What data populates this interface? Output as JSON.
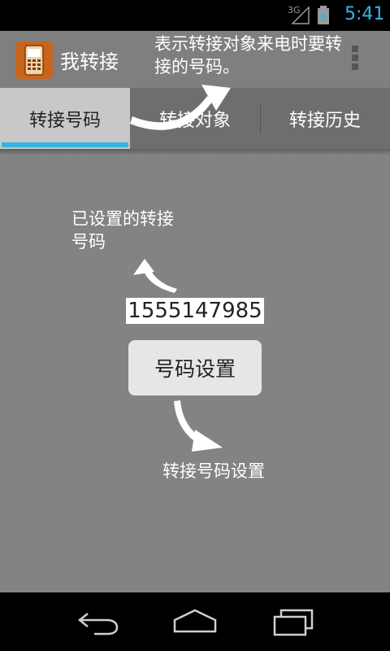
{
  "status_bar": {
    "network": "3G",
    "time": "5:41"
  },
  "action_bar": {
    "title": "我转接",
    "icon": "phone-icon",
    "overflow_icon": "overflow-menu-icon"
  },
  "tabs": [
    {
      "label": "转接号码",
      "selected": true
    },
    {
      "label": "转接对象",
      "selected": false
    },
    {
      "label": "转接历史",
      "selected": false
    }
  ],
  "main": {
    "forward_number": "1555147985",
    "set_button_label": "号码设置"
  },
  "annotations": {
    "tab_note": "表示转接对象来电时要转接的号码。",
    "saved_number_note": "已设置的转接号码",
    "set_button_note": "转接号码设置"
  },
  "nav_bar": {
    "back_icon": "back-icon",
    "home_icon": "home-icon",
    "recents_icon": "recent-apps-icon"
  },
  "colors": {
    "accent": "#33b5e5",
    "action_bar": "#7f7f7f",
    "content_bg": "#838383",
    "app_icon": "#c8651c"
  }
}
